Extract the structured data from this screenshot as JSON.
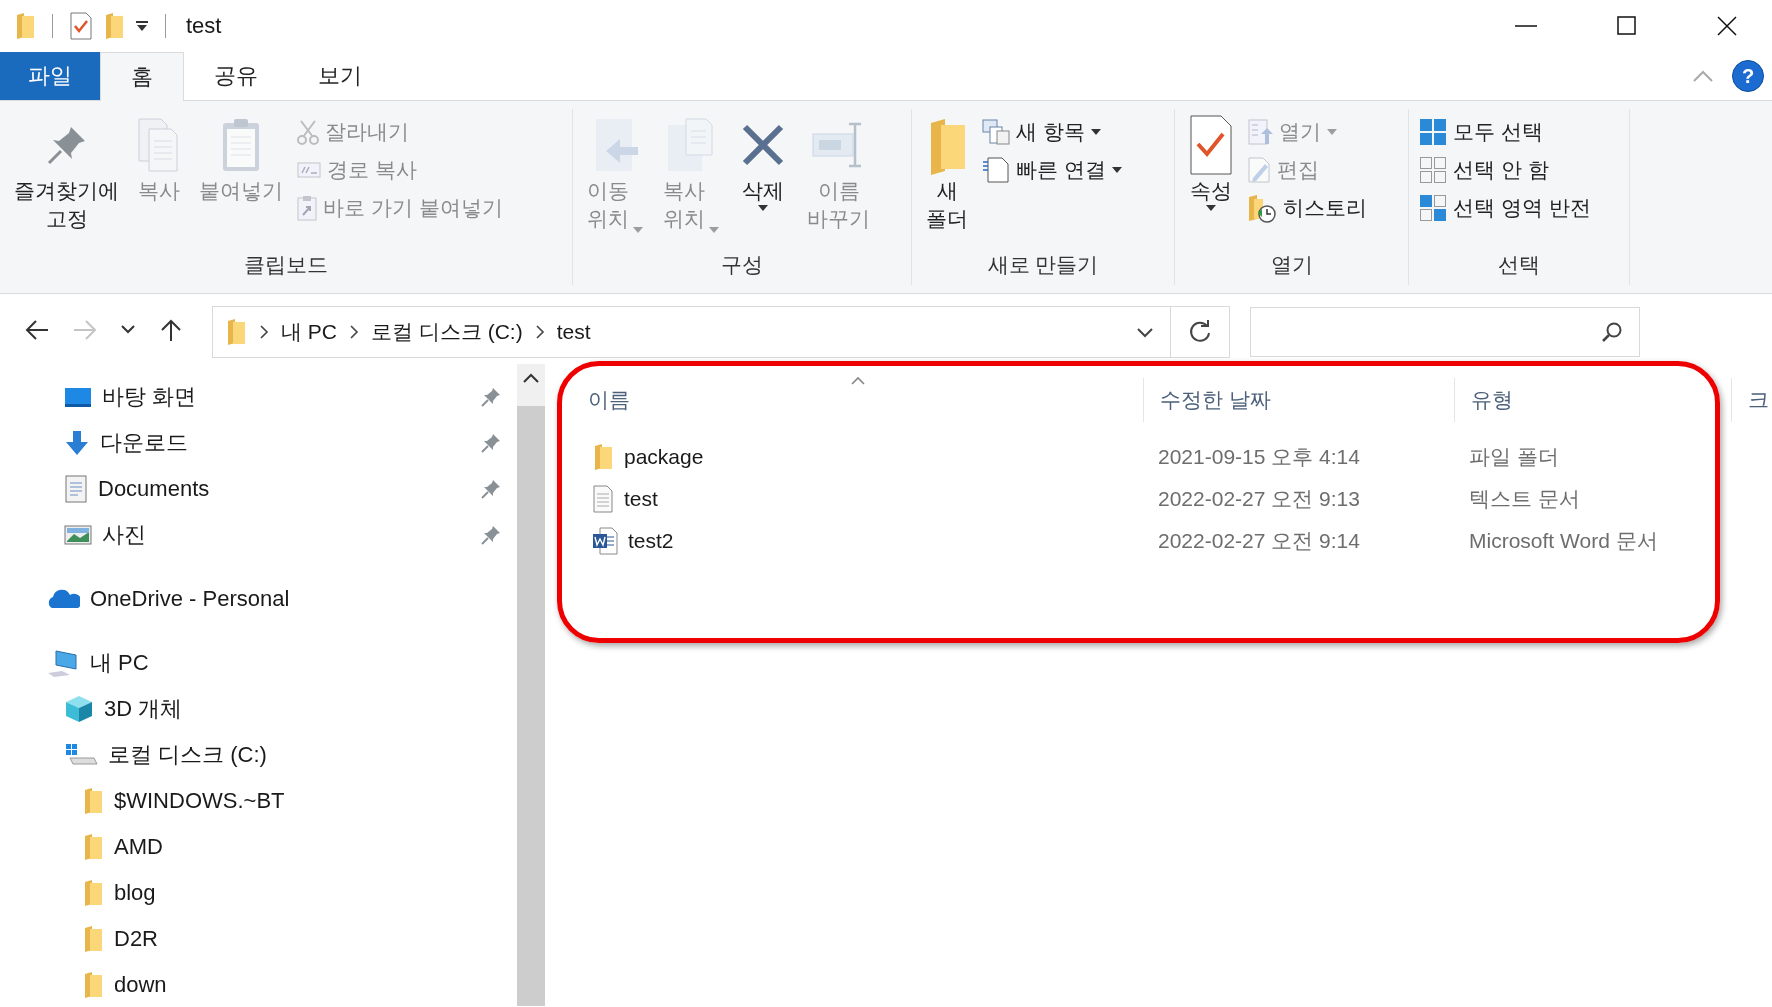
{
  "window": {
    "title": "test"
  },
  "ribbon_tabs": [
    {
      "label": "파일",
      "kind": "file",
      "selected": false
    },
    {
      "label": "홈",
      "kind": "tab",
      "selected": true
    },
    {
      "label": "공유",
      "kind": "tab",
      "selected": false
    },
    {
      "label": "보기",
      "kind": "tab",
      "selected": false
    }
  ],
  "help_button": "?",
  "ribbon_groups": [
    {
      "label": "클립보드",
      "items": [
        {
          "kind": "large",
          "lines": [
            "즐겨찾기에",
            "고정"
          ],
          "disabled": false,
          "menu": false
        },
        {
          "kind": "large",
          "lines": [
            "복사"
          ],
          "disabled": true,
          "menu": false
        },
        {
          "kind": "large",
          "lines": [
            "붙여넣기"
          ],
          "disabled": true,
          "menu": false
        },
        {
          "kind": "stack",
          "buttons": [
            {
              "label": "잘라내기",
              "disabled": true,
              "menu": false
            },
            {
              "label": "경로 복사",
              "disabled": true,
              "menu": false
            },
            {
              "label": "바로 가기 붙여넣기",
              "disabled": true,
              "menu": false
            }
          ]
        }
      ]
    },
    {
      "label": "구성",
      "items": [
        {
          "kind": "large",
          "lines": [
            "이동",
            "위치"
          ],
          "disabled": true,
          "menu": true
        },
        {
          "kind": "large",
          "lines": [
            "복사",
            "위치"
          ],
          "disabled": true,
          "menu": true
        },
        {
          "kind": "large",
          "lines": [
            "삭제"
          ],
          "disabled": false,
          "menu": true
        },
        {
          "kind": "large",
          "lines": [
            "이름",
            "바꾸기"
          ],
          "disabled": true,
          "menu": false
        }
      ]
    },
    {
      "label": "새로 만들기",
      "items": [
        {
          "kind": "large",
          "lines": [
            "새",
            "폴더"
          ],
          "disabled": false,
          "menu": false
        },
        {
          "kind": "stack",
          "buttons": [
            {
              "label": "새 항목",
              "disabled": false,
              "menu": true
            },
            {
              "label": "빠른 연결",
              "disabled": false,
              "menu": true
            }
          ]
        }
      ]
    },
    {
      "label": "열기",
      "items": [
        {
          "kind": "large",
          "lines": [
            "속성"
          ],
          "disabled": false,
          "menu": true
        },
        {
          "kind": "stack",
          "buttons": [
            {
              "label": "열기",
              "disabled": true,
              "menu": true
            },
            {
              "label": "편집",
              "disabled": true,
              "menu": false
            },
            {
              "label": "히스토리",
              "disabled": false,
              "menu": false
            }
          ]
        }
      ]
    },
    {
      "label": "선택",
      "items": [
        {
          "kind": "stack",
          "buttons": [
            {
              "label": "모두 선택",
              "disabled": false,
              "menu": false
            },
            {
              "label": "선택 안 함",
              "disabled": false,
              "menu": false
            },
            {
              "label": "선택 영역 반전",
              "disabled": false,
              "menu": false
            }
          ]
        }
      ]
    }
  ],
  "navigation": {
    "back_disabled": false,
    "forward_disabled": true
  },
  "address": {
    "crumbs": [
      "내 PC",
      "로컬 디스크 (C:)",
      "test"
    ]
  },
  "nav_pane": {
    "quick_access": [
      {
        "label": "바탕 화면",
        "kind": "desktop",
        "pinned": true
      },
      {
        "label": "다운로드",
        "kind": "download",
        "pinned": true
      },
      {
        "label": "Documents",
        "kind": "documents",
        "pinned": true
      },
      {
        "label": "사진",
        "kind": "pictures",
        "pinned": true
      }
    ],
    "trees": [
      {
        "label": "OneDrive - Personal",
        "kind": "onedrive"
      },
      {
        "label": "내 PC",
        "kind": "pc",
        "children": [
          {
            "label": "3D 개체",
            "kind": "cube"
          },
          {
            "label": "로컬 디스크 (C:)",
            "kind": "drive",
            "children": [
              {
                "label": "$WINDOWS.~BT",
                "kind": "folder"
              },
              {
                "label": "AMD",
                "kind": "folder"
              },
              {
                "label": "blog",
                "kind": "folder"
              },
              {
                "label": "D2R",
                "kind": "folder"
              },
              {
                "label": "down",
                "kind": "folder"
              }
            ]
          }
        ]
      }
    ]
  },
  "file_list": {
    "columns": [
      {
        "label": "이름",
        "sorted": true
      },
      {
        "label": "수정한 날짜",
        "sorted": false
      },
      {
        "label": "유형",
        "sorted": false
      },
      {
        "label": "크",
        "sorted": false
      }
    ],
    "rows": [
      {
        "name": "package",
        "kind": "folder",
        "modified": "2021-09-15 오후 4:14",
        "type": "파일 폴더"
      },
      {
        "name": "test",
        "kind": "text",
        "modified": "2022-02-27 오전 9:13",
        "type": "텍스트 문서"
      },
      {
        "name": "test2",
        "kind": "word",
        "modified": "2022-02-27 오전 9:14",
        "type": "Microsoft Word 문서"
      }
    ]
  }
}
